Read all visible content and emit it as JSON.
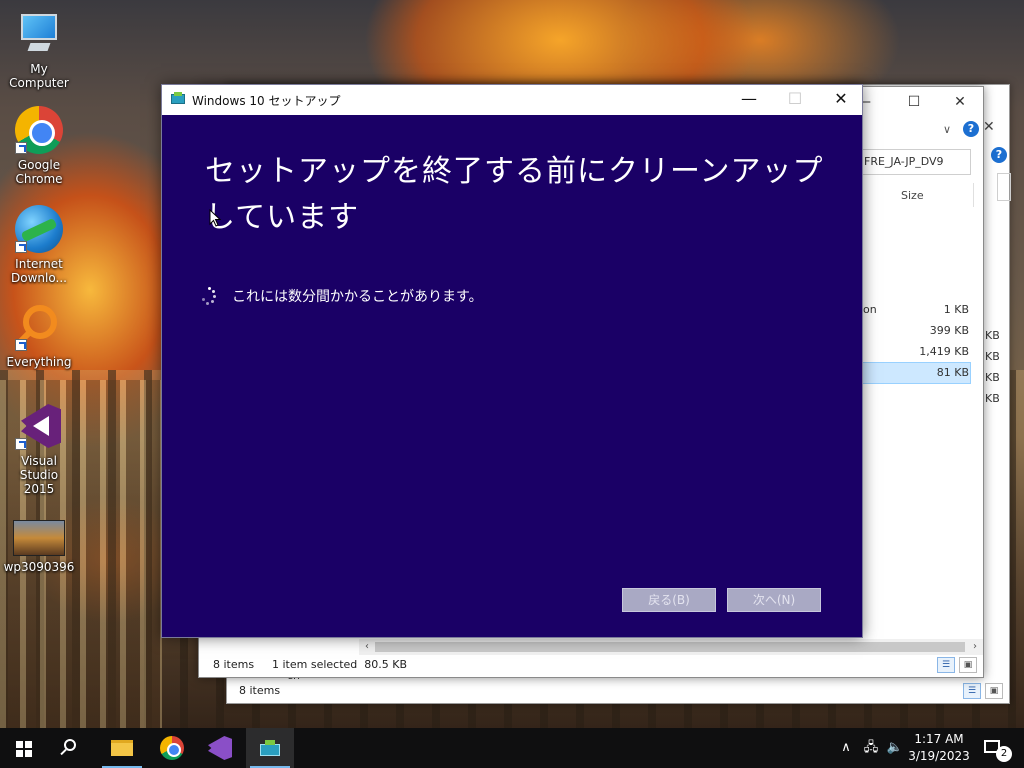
{
  "desktop": {
    "icons": [
      {
        "label": "My Computer",
        "icon": "computer-icon"
      },
      {
        "label": "Google Chrome",
        "icon": "chrome-icon"
      },
      {
        "label": "Internet Downlo...",
        "icon": "internet-download-manager-icon"
      },
      {
        "label": "Everything",
        "icon": "everything-search-icon"
      },
      {
        "label": "Visual Studio 2015",
        "icon": "visual-studio-icon"
      },
      {
        "label": "wp3090396",
        "icon": "image-file-icon"
      }
    ]
  },
  "explorer_front": {
    "address_text": "FRE_JA-JP_DV9",
    "column_size": "Size",
    "rows": [
      {
        "name": "on",
        "size": "1 KB"
      },
      {
        "name": "",
        "size": "399 KB"
      },
      {
        "name": "",
        "size": "1,419 KB"
      },
      {
        "name": "",
        "size": "81 KB",
        "selected": true
      }
    ],
    "status_items": "8 items",
    "status_selected": "1 item selected  80.5 KB"
  },
  "explorer_back": {
    "status_items": "8 items",
    "size_fragments": [
      "KB",
      "KB",
      "KB",
      "KB"
    ],
    "partial_row": "cn"
  },
  "setup": {
    "title": "Windows 10 セットアップ",
    "heading": "セットアップを終了する前にクリーンアップしています",
    "status": "これには数分間かかることがあります。",
    "back_button": "戻る(B)",
    "next_button": "次へ(N)",
    "accent_color": "#1a0066"
  },
  "taskbar": {
    "apps": [
      "start-icon",
      "search-icon",
      "file-explorer-icon",
      "chrome-icon",
      "visual-studio-icon",
      "windows-setup-icon"
    ],
    "clock_time": "1:17 AM",
    "clock_date": "3/19/2023",
    "notification_count": "2"
  }
}
